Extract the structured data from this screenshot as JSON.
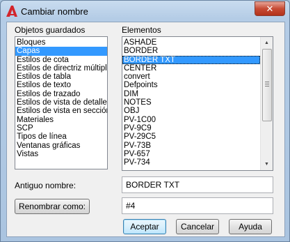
{
  "window": {
    "title": "Cambiar nombre",
    "close_symbol": "✕"
  },
  "saved_objects": {
    "label": "Objetos guardados",
    "items": [
      "Bloques",
      "Capas",
      "Estilos de cota",
      "Estilos de directriz múltiple",
      "Estilos de tabla",
      "Estilos de texto",
      "Estilos de trazado",
      "Estilos de vista de detalle",
      "Estilos de vista en sección",
      "Materiales",
      "SCP",
      "Tipos de línea",
      "Ventanas gráficas",
      "Vistas"
    ],
    "selected": "Capas"
  },
  "elements": {
    "label": "Elementos",
    "items": [
      "ASHADE",
      "BORDER",
      "BORDER TXT",
      "CENTER",
      "convert",
      "Defpoints",
      "DIM",
      "NOTES",
      "OBJ",
      "PV-1C00",
      "PV-9C9",
      "PV-29C5",
      "PV-73B",
      "PV-657",
      "PV-734"
    ],
    "selected": "BORDER TXT"
  },
  "old_name": {
    "label": "Antiguo nombre:",
    "value": "BORDER TXT"
  },
  "rename_to": {
    "button_label": "Renombrar como:",
    "value": "#4"
  },
  "buttons": {
    "accept": "Aceptar",
    "cancel": "Cancelar",
    "help": "Ayuda"
  },
  "icons": {
    "app": "autocad-a-icon",
    "close": "close-icon"
  },
  "colors": {
    "selection": "#3399ff",
    "close_button": "#c74b34",
    "app_icon": "#d3242b"
  }
}
